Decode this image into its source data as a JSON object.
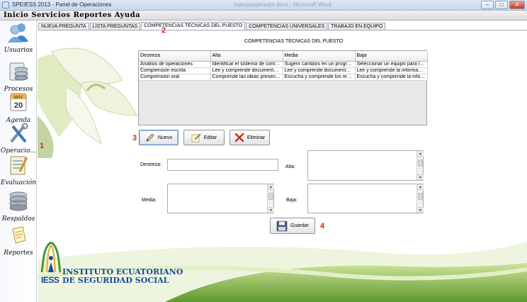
{
  "window": {
    "title": "SPEIESS 2013 - Panel de Operaciones",
    "ghost_title": "manualoperador.docx - Microsoft Word",
    "buttons": {
      "minimize": "–",
      "maximize": "□",
      "close": "✕"
    }
  },
  "menubar": [
    "Inicio",
    "Servicios",
    "Reportes",
    "Ayuda"
  ],
  "sidebar": {
    "items": [
      {
        "label": "Usuarios",
        "icon": "users-icon"
      },
      {
        "label": "Procesos",
        "icon": "database-icon"
      },
      {
        "label": "Agenda",
        "icon": "calendar-icon",
        "cal_month": "MAY",
        "cal_day": "20"
      },
      {
        "label": "Operacio...",
        "icon": "tools-icon"
      },
      {
        "label": "Evaluación",
        "icon": "checklist-icon"
      },
      {
        "label": "Respaldos",
        "icon": "disk-stack-icon"
      },
      {
        "label": "Reportes",
        "icon": "report-icon"
      }
    ]
  },
  "tabs": [
    {
      "label": "NUEVA PREGUNTA",
      "active": false
    },
    {
      "label": "LISTA PREGUNTAS",
      "active": false
    },
    {
      "label": "COMPETENCIAS TÉCNICAS DEL PUESTO",
      "active": true
    },
    {
      "label": "COMPETENCIAS UNIVERSALES",
      "active": false
    },
    {
      "label": "TRABAJO EN EQUIPO",
      "active": false
    }
  ],
  "annotations": {
    "a1": "1",
    "a2": "2",
    "a3": "3",
    "a4": "4"
  },
  "panel": {
    "title": "COMPETENCIAS TÉCNICAS DEL PUESTO",
    "table": {
      "columns": [
        "Destreza",
        "Alta",
        "Media",
        "Baja"
      ],
      "rows": [
        [
          "Análisis de operaciones",
          "Identificar el sistema de control r...",
          "Sugerir cambios en un programa ...",
          "Seleccionar un equipo para la ofi..."
        ],
        [
          "Comprensión escrita",
          "Lee y comprende documentos de...",
          "Lee y comprende documentos de...",
          "Lee y comprende la información s..."
        ],
        [
          "Comprensión oral",
          "Comprende las ideas presentada...",
          "Escucha y comprende los requeri...",
          "Escucha y comprende la informac..."
        ]
      ]
    },
    "buttons": {
      "nuevo": "Nuevo",
      "editar": "Editar",
      "eliminar": "Eliminar",
      "guardar": "Guardar"
    },
    "form": {
      "destreza_label": "Destreza:",
      "alta_label": "Alta:",
      "media_label": "Media:",
      "baja_label": "Baja:",
      "destreza_value": "",
      "alta_value": "",
      "media_value": "",
      "baja_value": ""
    }
  },
  "logo": {
    "line1": "INSTITUTO ECUATORIANO",
    "line2": "DE SEGURIDAD SOCIAL",
    "acronym": "IESS"
  },
  "colors": {
    "accent": "#d2281d",
    "brand_blue": "#174a9c",
    "brand_green": "#3e9a3c"
  }
}
